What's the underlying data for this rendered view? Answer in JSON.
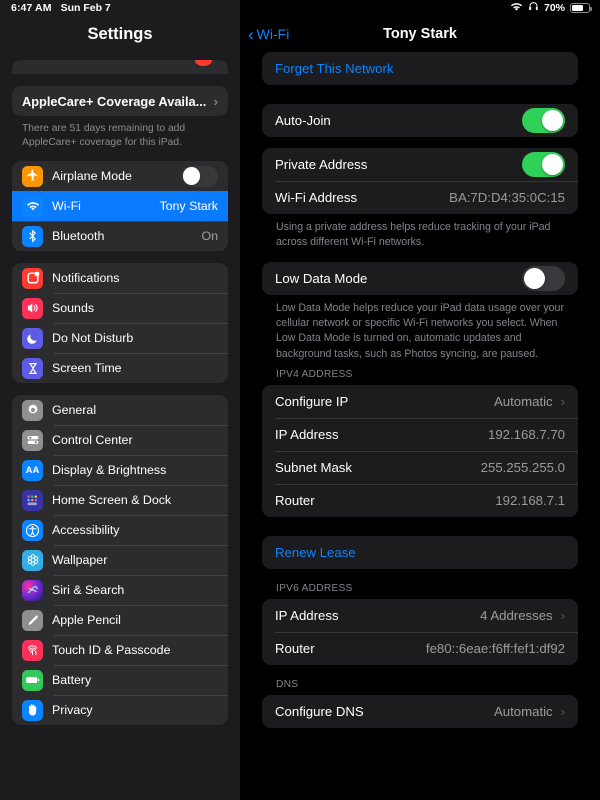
{
  "status_bar": {
    "time": "6:47 AM",
    "date": "Sun Feb 7",
    "wifi_icon": "wifi-icon",
    "headphones_icon": "headphones-icon",
    "battery_percent": "70%",
    "battery_icon": "battery-icon"
  },
  "sidebar": {
    "title": "Settings",
    "applecare": {
      "label": "AppleCare+ Coverage Availa...",
      "chevron": "›",
      "note": "There are 51 days remaining to add AppleCare+ coverage for this iPad."
    },
    "groups": [
      {
        "items": [
          {
            "label": "Airplane Mode",
            "icon": "airplane-icon",
            "control": "toggle",
            "toggle_on": false,
            "value": ""
          },
          {
            "label": "Wi-Fi",
            "icon": "wifi-icon",
            "control": "value",
            "value": "Tony Stark",
            "selected": true
          },
          {
            "label": "Bluetooth",
            "icon": "bluetooth-icon",
            "control": "value",
            "value": "On"
          }
        ]
      },
      {
        "items": [
          {
            "label": "Notifications",
            "icon": "notifications-icon",
            "control": "none",
            "value": ""
          },
          {
            "label": "Sounds",
            "icon": "sounds-icon",
            "control": "none",
            "value": ""
          },
          {
            "label": "Do Not Disturb",
            "icon": "moon-icon",
            "control": "none",
            "value": ""
          },
          {
            "label": "Screen Time",
            "icon": "hourglass-icon",
            "control": "none",
            "value": ""
          }
        ]
      },
      {
        "items": [
          {
            "label": "General",
            "icon": "gear-icon",
            "control": "none",
            "value": ""
          },
          {
            "label": "Control Center",
            "icon": "control-center-icon",
            "control": "none",
            "value": ""
          },
          {
            "label": "Display & Brightness",
            "icon": "display-brightness-icon",
            "control": "none",
            "value": ""
          },
          {
            "label": "Home Screen & Dock",
            "icon": "home-screen-dock-icon",
            "control": "none",
            "value": ""
          },
          {
            "label": "Accessibility",
            "icon": "accessibility-icon",
            "control": "none",
            "value": ""
          },
          {
            "label": "Wallpaper",
            "icon": "wallpaper-icon",
            "control": "none",
            "value": ""
          },
          {
            "label": "Siri & Search",
            "icon": "siri-icon",
            "control": "none",
            "value": ""
          },
          {
            "label": "Apple Pencil",
            "icon": "apple-pencil-icon",
            "control": "none",
            "value": ""
          },
          {
            "label": "Touch ID & Passcode",
            "icon": "touch-id-icon",
            "control": "none",
            "value": ""
          },
          {
            "label": "Battery",
            "icon": "battery-icon",
            "control": "none",
            "value": ""
          },
          {
            "label": "Privacy",
            "icon": "privacy-hand-icon",
            "control": "none",
            "value": ""
          }
        ]
      }
    ]
  },
  "detail": {
    "back_label": "Wi-Fi",
    "back_chevron": "‹",
    "title": "Tony Stark",
    "forget_network": {
      "label": "Forget This Network",
      "highlighted": true,
      "highlight_color": "#ff3b20"
    },
    "auto_join": {
      "label": "Auto-Join",
      "toggle_on": true
    },
    "private_address": {
      "label": "Private Address",
      "toggle_on": true,
      "wifi_address_label": "Wi-Fi Address",
      "wifi_address_value": "BA:7D:D4:35:0C:15",
      "note": "Using a private address helps reduce tracking of your iPad across different Wi-Fi networks."
    },
    "low_data_mode": {
      "label": "Low Data Mode",
      "toggle_on": false,
      "note": "Low Data Mode helps reduce your iPad data usage over your cellular network or specific Wi-Fi networks you select. When Low Data Mode is turned on, automatic updates and background tasks, such as Photos syncing, are paused."
    },
    "ipv4": {
      "header": "IPV4 ADDRESS",
      "rows": [
        {
          "label": "Configure IP",
          "value": "Automatic",
          "chevron": "›"
        },
        {
          "label": "IP Address",
          "value": "192.168.7.70",
          "chevron": ""
        },
        {
          "label": "Subnet Mask",
          "value": "255.255.255.0",
          "chevron": ""
        },
        {
          "label": "Router",
          "value": "192.168.7.1",
          "chevron": ""
        }
      ]
    },
    "renew_lease": {
      "label": "Renew Lease"
    },
    "ipv6": {
      "header": "IPV6 ADDRESS",
      "rows": [
        {
          "label": "IP Address",
          "value": "4 Addresses",
          "chevron": "›"
        },
        {
          "label": "Router",
          "value": "fe80::6eae:f6ff:fef1:df92",
          "chevron": ""
        }
      ]
    },
    "dns": {
      "header": "DNS",
      "rows": [
        {
          "label": "Configure DNS",
          "value": "Automatic",
          "chevron": "›"
        }
      ]
    }
  },
  "colors": {
    "accent_blue": "#0a84ff",
    "selected_row": "#0a7aff",
    "toggle_green": "#30d158",
    "highlight_red": "#ff3b20",
    "card": "#1c1c1e",
    "sidebar_card": "#2c2c2e"
  }
}
